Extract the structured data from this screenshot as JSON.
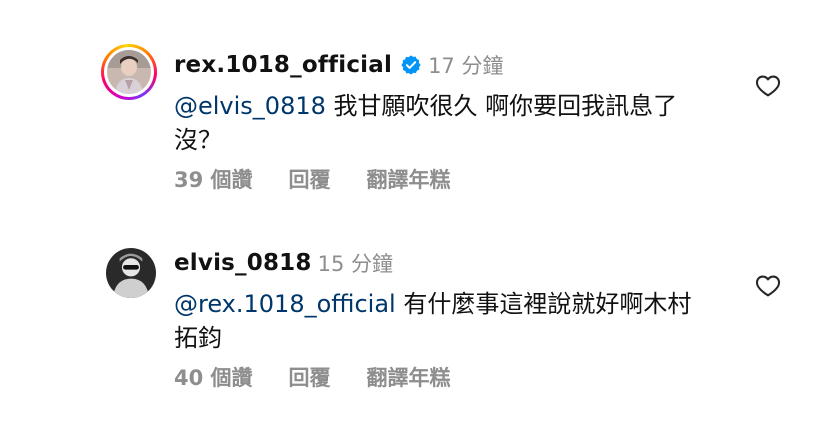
{
  "comments": [
    {
      "username": "rex.1018_official",
      "verified": true,
      "timestamp": "17 分鐘",
      "mention": "@elvis_0818",
      "text": " 我甘願吹很久 啊你要回我訊息了沒？",
      "likes": "39 個讚",
      "reply": "回覆",
      "translate": "翻譯年糕",
      "avatar_icon": "profile-photo",
      "has_story_ring": true
    },
    {
      "username": "elvis_0818",
      "verified": false,
      "timestamp": "15 分鐘",
      "mention": "@rex.1018_official",
      "text": " 有什麼事這裡說就好啊木村拓鈞",
      "likes": "40 個讚",
      "reply": "回覆",
      "translate": "翻譯年糕",
      "avatar_icon": "profile-photo",
      "has_story_ring": false
    }
  ],
  "colors": {
    "mention": "#00376b",
    "meta": "#8e8e8e",
    "verified": "#0095f6",
    "text": "#111111"
  },
  "icons": {
    "like": "heart-outline-icon",
    "verified": "verified-badge-icon"
  }
}
